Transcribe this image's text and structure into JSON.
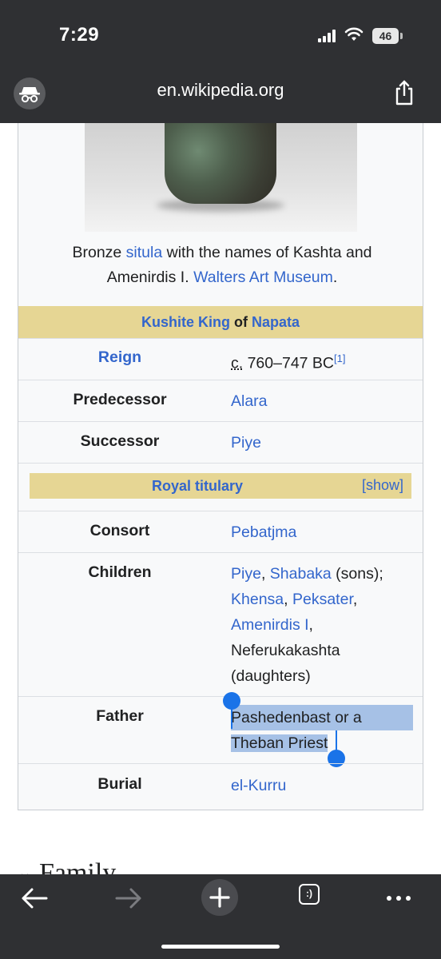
{
  "status_bar": {
    "time": "7:29",
    "battery": "46"
  },
  "browser": {
    "url": "en.wikipedia.org"
  },
  "infobox": {
    "caption_parts": [
      "Bronze ",
      "situla",
      " with the names of Kashta and Amenirdis I. ",
      "Walters Art Museum",
      "."
    ],
    "header": {
      "title": "Kushite King",
      "connector": " of ",
      "place": "Napata"
    },
    "reign": {
      "label": "Reign",
      "circa": "c.",
      "value": " 760–747 BC",
      "ref": "[1]"
    },
    "predecessor": {
      "label": "Predecessor",
      "value": "Alara"
    },
    "successor": {
      "label": "Successor",
      "value": "Piye"
    },
    "titulary": {
      "title": "Royal titulary",
      "toggle": "[show]"
    },
    "consort": {
      "label": "Consort",
      "value": "Pebatjma"
    },
    "children": {
      "label": "Children",
      "items": [
        "Piye",
        ", ",
        "Shabaka",
        " (sons);",
        "Khensa",
        ", ",
        "Peksater",
        ",",
        "Amenirdis I",
        ",",
        "Neferukakashta",
        "(daughters)"
      ]
    },
    "father": {
      "label": "Father",
      "line1": "Pashedenbast or a",
      "line2": "Theban Priest"
    },
    "burial": {
      "label": "Burial",
      "value": "el-Kurru"
    }
  },
  "section": {
    "heading": "Family"
  },
  "toolbar": {
    "tabs_glyph": ":)"
  }
}
